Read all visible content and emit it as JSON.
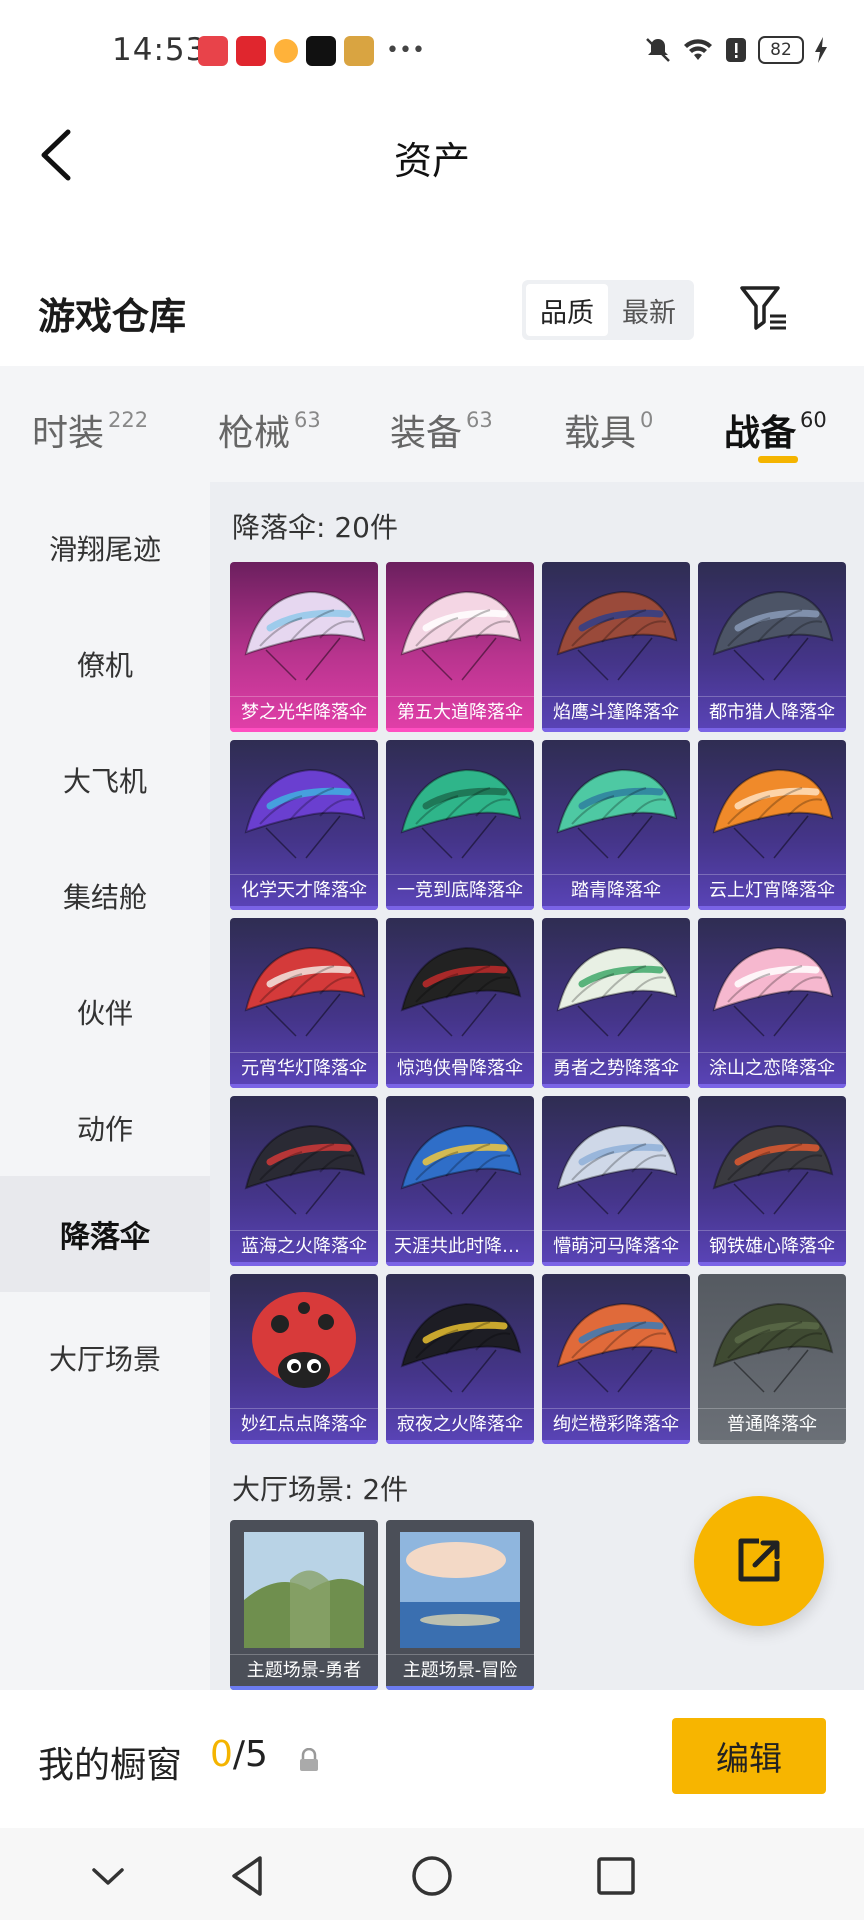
{
  "status_bar": {
    "time": "14:53",
    "battery": "82"
  },
  "header": {
    "title": "资产"
  },
  "section": {
    "title": "游戏仓库",
    "sort_options": [
      "品质",
      "最新"
    ]
  },
  "tabs": [
    {
      "label": "时装",
      "count": "222"
    },
    {
      "label": "枪械",
      "count": "63"
    },
    {
      "label": "装备",
      "count": "63"
    },
    {
      "label": "载具",
      "count": "0"
    },
    {
      "label": "战备",
      "count": "60"
    }
  ],
  "sidenav": [
    "滑翔尾迹",
    "僚机",
    "大飞机",
    "集结舱",
    "伙伴",
    "动作",
    "降落伞",
    "大厅场景"
  ],
  "groups": {
    "parachute": {
      "title": "降落伞: 20件",
      "items": [
        "梦之光华降落伞",
        "第五大道降落伞",
        "焰鹰斗篷降落伞",
        "都市猎人降落伞",
        "化学天才降落伞",
        "一竞到底降落伞",
        "踏青降落伞",
        "云上灯宵降落伞",
        "元宵华灯降落伞",
        "惊鸿侠骨降落伞",
        "勇者之势降落伞",
        "涂山之恋降落伞",
        "蓝海之火降落伞",
        "天涯共此时降落伞",
        "懵萌河马降落伞",
        "钢铁雄心降落伞",
        "妙红点点降落伞",
        "寂夜之火降落伞",
        "绚烂橙彩降落伞",
        "普通降落伞"
      ]
    },
    "scene": {
      "title": "大厅场景: 2件",
      "items": [
        "主题场景-勇者",
        "主题场景-冒险"
      ]
    }
  },
  "showcase": {
    "label": "我的橱窗",
    "used": "0",
    "total": "/5",
    "edit_label": "编辑"
  }
}
